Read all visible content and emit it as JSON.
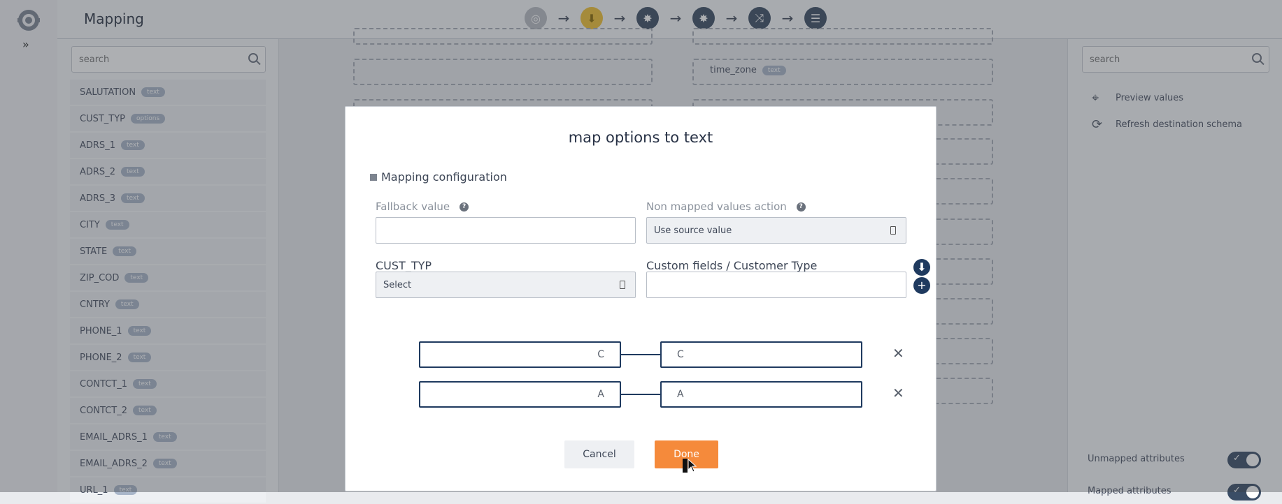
{
  "topbar": {
    "title": "Mapping",
    "steps": [
      {
        "icon": "source-icon",
        "style": "gray",
        "glyph": "◎"
      },
      {
        "icon": "filter-icon",
        "style": "gold",
        "glyph": "⬇"
      },
      {
        "icon": "gear-icon",
        "style": "dark",
        "glyph": "✸"
      },
      {
        "icon": "gear-icon",
        "style": "dark",
        "glyph": "✸"
      },
      {
        "icon": "shuffle-icon",
        "style": "dark",
        "glyph": "⤨"
      },
      {
        "icon": "sliders-icon",
        "style": "dark",
        "glyph": "☰"
      }
    ]
  },
  "left_panel": {
    "search_placeholder": "search",
    "attributes": [
      {
        "name": "SALUTATION",
        "type": "text"
      },
      {
        "name": "CUST_TYP",
        "type": "options"
      },
      {
        "name": "ADRS_1",
        "type": "text"
      },
      {
        "name": "ADRS_2",
        "type": "text"
      },
      {
        "name": "ADRS_3",
        "type": "text"
      },
      {
        "name": "CITY",
        "type": "text"
      },
      {
        "name": "STATE",
        "type": "text"
      },
      {
        "name": "ZIP_COD",
        "type": "text"
      },
      {
        "name": "CNTRY",
        "type": "text"
      },
      {
        "name": "PHONE_1",
        "type": "text"
      },
      {
        "name": "PHONE_2",
        "type": "text"
      },
      {
        "name": "CONTCT_1",
        "type": "text"
      },
      {
        "name": "CONTCT_2",
        "type": "text"
      },
      {
        "name": "EMAIL_ADRS_1",
        "type": "text"
      },
      {
        "name": "EMAIL_ADRS_2",
        "type": "text"
      },
      {
        "name": "URL_1",
        "type": "text"
      }
    ]
  },
  "canvas": {
    "time_zone_label": "time_zone",
    "time_zone_type": "text"
  },
  "right_panel": {
    "search_placeholder": "search",
    "preview_values": "Preview values",
    "refresh_schema": "Refresh destination schema",
    "unmapped_attributes": "Unmapped attributes",
    "mapped_attributes": "Mapped attributes"
  },
  "modal": {
    "title": "map options to text",
    "section": "Mapping configuration",
    "fallback_label": "Fallback value",
    "fallback_value": "",
    "non_mapped_label": "Non mapped values action",
    "non_mapped_value": "Use source value",
    "source_field_label": "CUST_TYP",
    "source_select_value": "Select",
    "target_field_label": "Custom fields / Customer Type",
    "target_value": "",
    "mappings": [
      {
        "source": "C",
        "target": "C"
      },
      {
        "source": "A",
        "target": "A"
      }
    ],
    "cancel_label": "Cancel",
    "done_label": "Done"
  }
}
